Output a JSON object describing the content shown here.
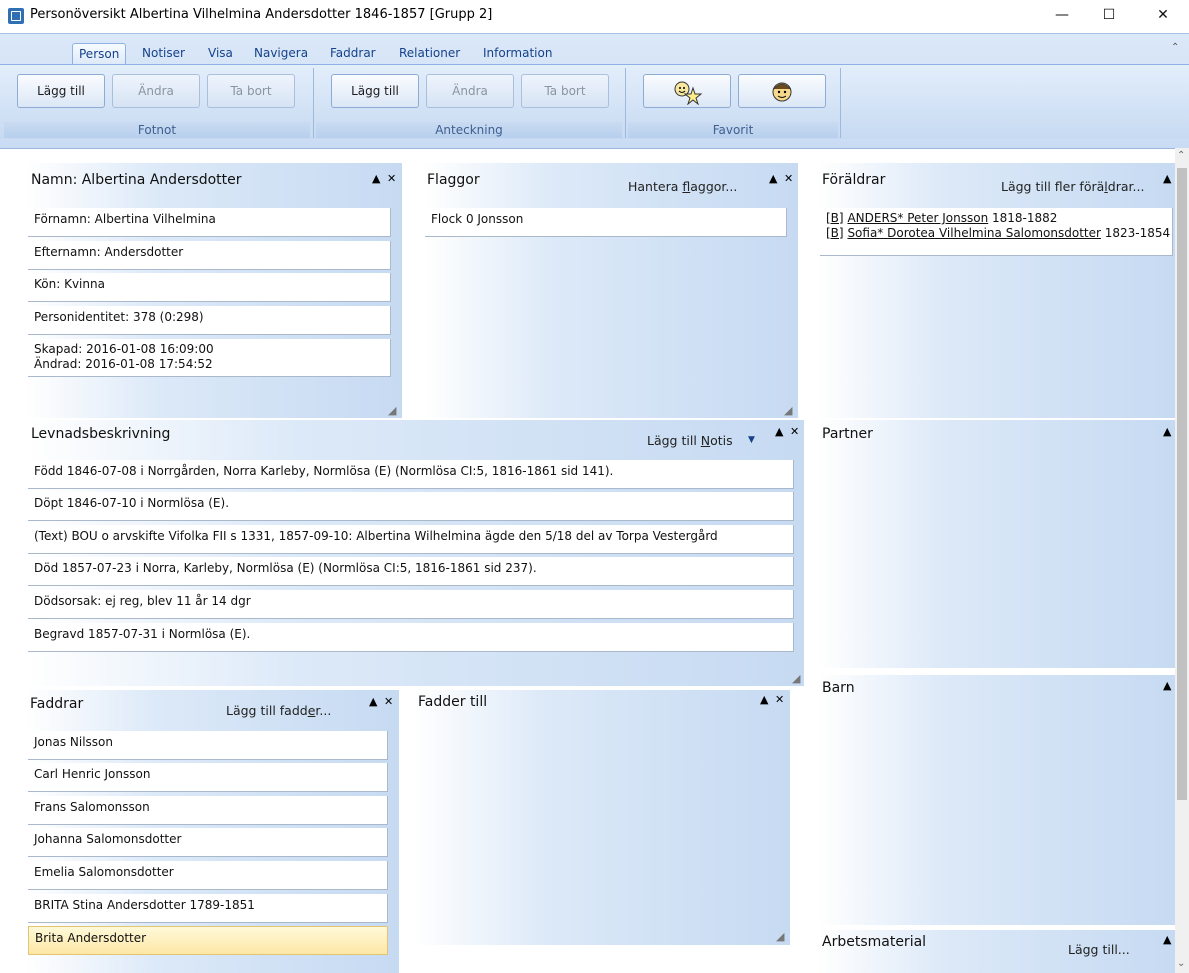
{
  "window": {
    "title": "Personöversikt Albertina Vilhelmina Andersdotter 1846-1857 [Grupp 2]",
    "minimize": "—",
    "maximize": "☐",
    "close": "✕"
  },
  "ribbon": {
    "tabs": [
      "Person",
      "Notiser",
      "Visa",
      "Navigera",
      "Faddrar",
      "Relationer",
      "Information"
    ],
    "active_tab": "Person",
    "groups": {
      "fotnot": {
        "label": "Fotnot",
        "add": "Lägg till",
        "edit": "Ändra",
        "remove": "Ta bort"
      },
      "anteckning": {
        "label": "Anteckning",
        "add": "Lägg till",
        "edit": "Ändra",
        "remove": "Ta bort"
      },
      "favorit": {
        "label": "Favorit",
        "star_icon": "star-face-icon",
        "face_icon": "smiley-face-icon"
      }
    }
  },
  "panels": {
    "namn": {
      "title": "Namn: Albertina Andersdotter",
      "fields": {
        "fornamn": "Förnamn: Albertina Vilhelmina",
        "efternamn": "Efternamn: Andersdotter",
        "kon": "Kön: Kvinna",
        "personidentitet": "Personidentitet: 378 (0:298)",
        "skapad": "Skapad: 2016-01-08 16:09:00",
        "andrad": "Ändrad: 2016-01-08 17:54:52"
      }
    },
    "flaggor": {
      "title": "Flaggor",
      "link_pre": "Hantera ",
      "link_u": "f",
      "link_post": "laggor...",
      "items": [
        "Flock 0 Jonsson"
      ]
    },
    "foraldrar": {
      "title": "Föräldrar",
      "link_pre": "Lägg till fler förä",
      "link_u": "l",
      "link_post": "drar...",
      "parents": [
        {
          "tag": "[B]",
          "name": "ANDERS* Peter Jonsson",
          "years": " 1818-1882"
        },
        {
          "tag": "[B]",
          "name": "Sofia* Dorotea Vilhelmina Salomonsdotter",
          "years": " 1823-1854"
        }
      ]
    },
    "levnad": {
      "title": "Levnadsbeskrivning",
      "link_pre": "Lägg till ",
      "link_u": "N",
      "link_post": "otis",
      "dropdown": "▼",
      "items": [
        "Född 1846-07-08 i Norrgården, Norra Karleby, Normlösa (E) (Normlösa CI:5, 1816-1861 sid  141).",
        "Döpt 1846-07-10 i Normlösa (E).",
        "(Text) BOU o arvskifte  Vifolka FII s 1331, 1857-09-10:  Albertina Wilhelmina ägde den  5/18 del av Torpa Vestergård",
        "Död 1857-07-23 i Norra, Karleby, Normlösa (E) (Normlösa CI:5, 1816-1861 sid  237).",
        "Dödsorsak: ej reg, blev 11 år 14 dgr",
        "Begravd 1857-07-31 i Normlösa (E)."
      ]
    },
    "partner": {
      "title": "Partner"
    },
    "barn": {
      "title": "Barn"
    },
    "faddrar": {
      "title": "Faddrar",
      "link_pre": "Lägg till fadd",
      "link_u": "e",
      "link_post": "r...",
      "items": [
        "Jonas Nilsson",
        "Carl Henric Jonsson",
        "Frans Salomonsson",
        "Johanna Salomonsdotter",
        "Emelia Salomonsdotter",
        "BRITA Stina Andersdotter 1789-1851",
        "Brita Andersdotter"
      ],
      "selected_index": 6
    },
    "fadder_till": {
      "title": "Fadder till"
    },
    "arbetsmaterial": {
      "title": "Arbetsmaterial",
      "link": "Lägg till..."
    }
  },
  "controls": {
    "pin": "▲",
    "close": "✕",
    "grip": "◢"
  }
}
